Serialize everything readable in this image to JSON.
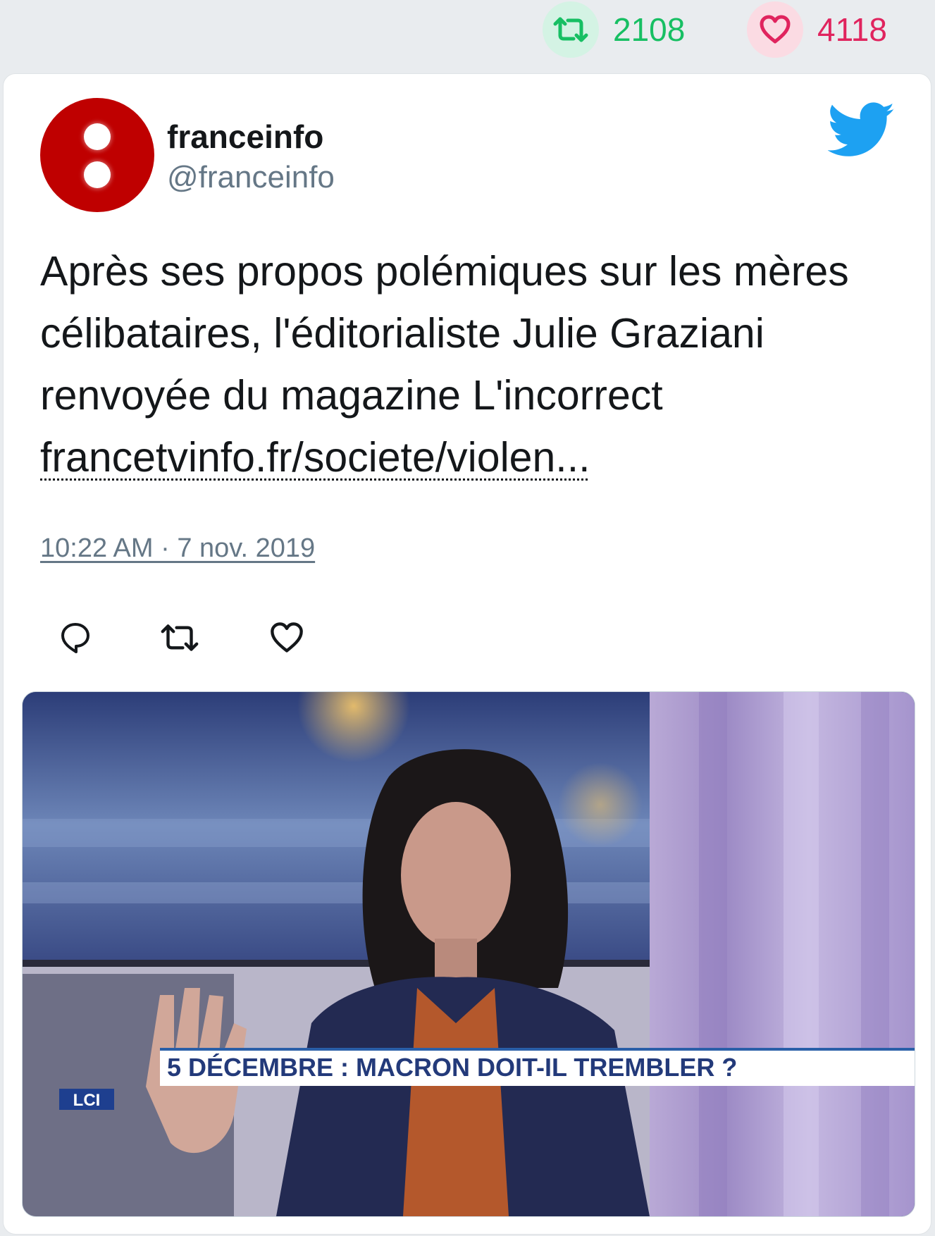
{
  "stats": {
    "retweets": "2108",
    "likes": "4118",
    "retweet_icon": "retweet-icon",
    "like_icon": "heart-icon",
    "retweet_color": "#17bf63",
    "like_color": "#e0245e"
  },
  "tweet": {
    "author_name": "franceinfo",
    "author_handle": "@franceinfo",
    "text": "Après ses propos polémiques sur les mères célibataires, l'éditorialiste Julie Graziani renvoyée du magazine L'incorrect ",
    "link": "francetvinfo.fr/societe/violen...",
    "timestamp": "10:22 AM · 7 nov. 2019",
    "brand_color": "#1da1f2",
    "avatar_color": "#bf0000"
  },
  "actions": {
    "reply_icon": "reply-icon",
    "retweet_icon": "retweet-icon",
    "like_icon": "heart-icon"
  },
  "media": {
    "banner_text": "5 DÉCEMBRE : MACRON DOIT-IL TREMBLER ?",
    "channel_logo": "LCI"
  }
}
